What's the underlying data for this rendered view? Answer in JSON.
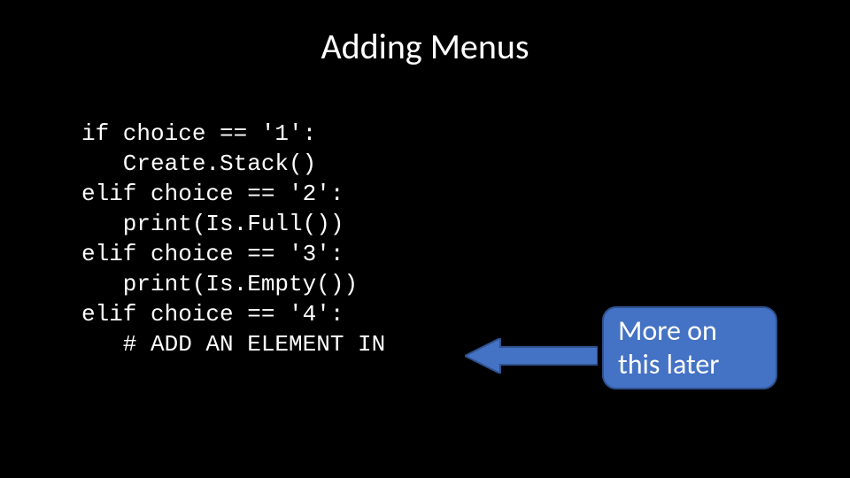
{
  "title": "Adding Menus",
  "code": "if choice == '1':\n   Create.Stack()\nelif choice == '2':\n   print(Is.Full())\nelif choice == '3':\n   print(Is.Empty())\nelif choice == '4':\n   # ADD AN ELEMENT IN",
  "callout_line1": "More on",
  "callout_line2": "this later",
  "colors": {
    "background": "#000000",
    "text": "#ffffff",
    "callout_fill": "#4472c4",
    "callout_border": "#2f528f"
  }
}
